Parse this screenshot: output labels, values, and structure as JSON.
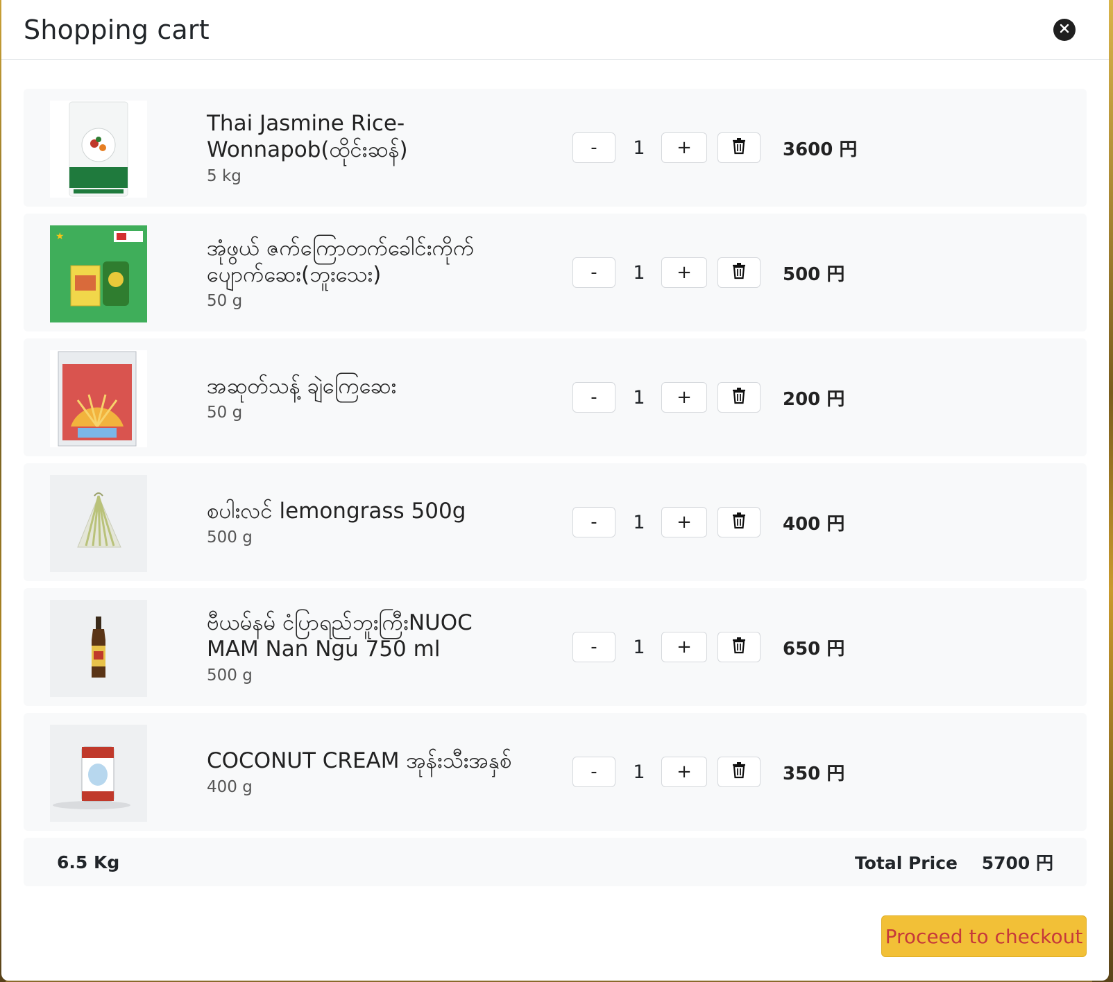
{
  "modal": {
    "title": "Shopping cart"
  },
  "cart": {
    "items": [
      {
        "name_line1": "Thai Jasmine Rice-",
        "name_line2": "Wonnapob(ထိုင်းဆန်)",
        "weight": "5 kg",
        "minus": "-",
        "quantity": "1",
        "plus": "+",
        "price": "3600 円"
      },
      {
        "name_line1": "အုံဖွယ် ဇက်ကြောတက်ခေါင်းကိုက်",
        "name_line2": "ပျောက်ဆေး(ဘူးသေး)",
        "weight": "50 g",
        "minus": "-",
        "quantity": "1",
        "plus": "+",
        "price": "500 円"
      },
      {
        "name_line1": "အဆုတ်သန့် ချဲကြေဆေး",
        "name_line2": "",
        "weight": "50 g",
        "minus": "-",
        "quantity": "1",
        "plus": "+",
        "price": "200 円"
      },
      {
        "name_line1": "စပါးလင် lemongrass 500g",
        "name_line2": "",
        "weight": "500 g",
        "minus": "-",
        "quantity": "1",
        "plus": "+",
        "price": "400 円"
      },
      {
        "name_line1": "ဗီယမ်နမ် ငံပြာရည်ဘူးကြီးNUOC",
        "name_line2": "MAM Nan Ngu 750 ml",
        "weight": "500 g",
        "minus": "-",
        "quantity": "1",
        "plus": "+",
        "price": "650 円"
      },
      {
        "name_line1": "COCONUT CREAM အုန်းသီးအနှစ်",
        "name_line2": "",
        "weight": "400 g",
        "minus": "-",
        "quantity": "1",
        "plus": "+",
        "price": "350 円"
      }
    ]
  },
  "summary": {
    "total_weight": "6.5 Kg",
    "total_label": "Total Price",
    "total_price": "5700 円"
  },
  "checkout": {
    "label": "Proceed to checkout"
  },
  "icons": {
    "close": "close-icon",
    "delete": "trash-icon"
  },
  "colors": {
    "checkout_bg": "#f2c037",
    "checkout_text": "#c63a3a",
    "row_bg": "#f8f9fa"
  }
}
